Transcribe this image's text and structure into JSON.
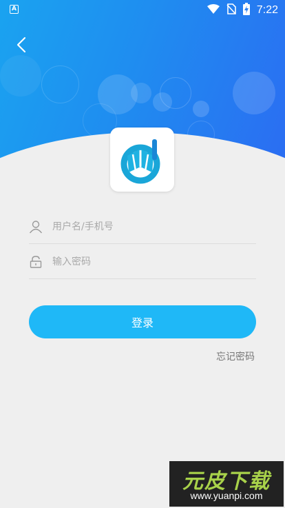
{
  "status_bar": {
    "time": "7:22",
    "app_icon_label": "A",
    "icons": [
      "app-notification-icon",
      "wifi-icon",
      "no-sim-icon",
      "battery-charging-icon"
    ]
  },
  "header": {
    "back_icon": "back-arrow-icon",
    "colors": {
      "gradient_start": "#1aa3f0",
      "gradient_end": "#2b6df2"
    }
  },
  "login_form": {
    "username_placeholder": "用户名/手机号",
    "password_placeholder": "输入密码",
    "username_icon": "user-icon",
    "password_icon": "lock-icon",
    "login_label": "登录",
    "forgot_label": "忘记密码",
    "accent_color": "#1fb8f7"
  },
  "watermark": {
    "logo_text": "元皮下载",
    "url": "www.yuanpi.com"
  }
}
